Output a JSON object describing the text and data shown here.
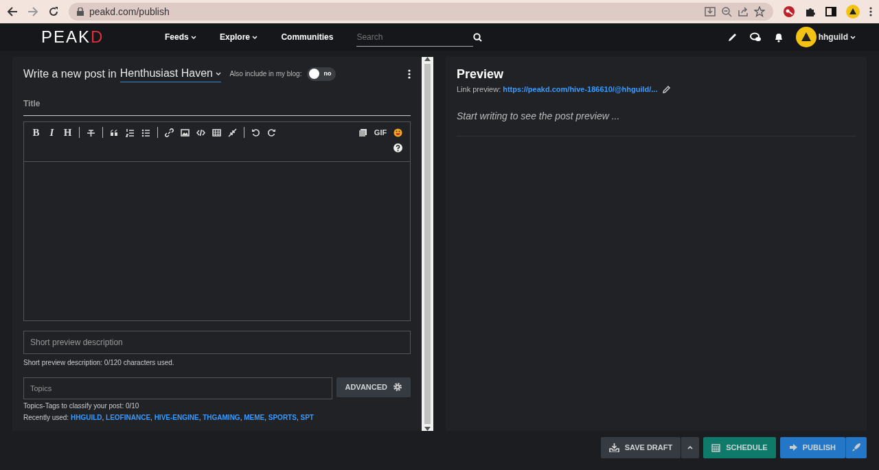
{
  "browser": {
    "url": "peakd.com/publish"
  },
  "navbar": {
    "logo": "PEAKD",
    "links": [
      {
        "label": "Feeds",
        "dropdown": true
      },
      {
        "label": "Explore",
        "dropdown": true
      },
      {
        "label": "Communities",
        "dropdown": false
      }
    ],
    "search": {
      "placeholder": "Search"
    },
    "user": "hhguild"
  },
  "editor": {
    "heading": "Write a new post in",
    "community": "Henthusiast Haven",
    "blog_toggle": {
      "label": "Also include in my blog:",
      "on": false,
      "text": "no"
    },
    "title": {
      "placeholder": "Title"
    },
    "toolbar": {
      "bold": "B",
      "italic": "I",
      "heading": "H",
      "gif": "GIF"
    },
    "description": {
      "placeholder": "Short preview description",
      "hint": "Short preview description: 0/120 characters used."
    },
    "topics": {
      "placeholder": "Topics",
      "advanced": "ADVANCED",
      "hint": "Topics-Tags to classify your post: 0/10",
      "recent_label": "Recently used:",
      "separator": ",",
      "recent": [
        "HHGUILD",
        "LEOFINANCE",
        "HIVE-ENGINE",
        "THGAMING",
        "MEME",
        "SPORTS",
        "SPT"
      ]
    }
  },
  "preview": {
    "title": "Preview",
    "link_label": "Link preview:",
    "link": "https://peakd.com/hive-186610/@hhguild/...",
    "empty": "Start writing to see the post preview ..."
  },
  "footer": {
    "save_draft": "SAVE DRAFT",
    "schedule": "SCHEDULE",
    "publish": "PUBLISH"
  }
}
